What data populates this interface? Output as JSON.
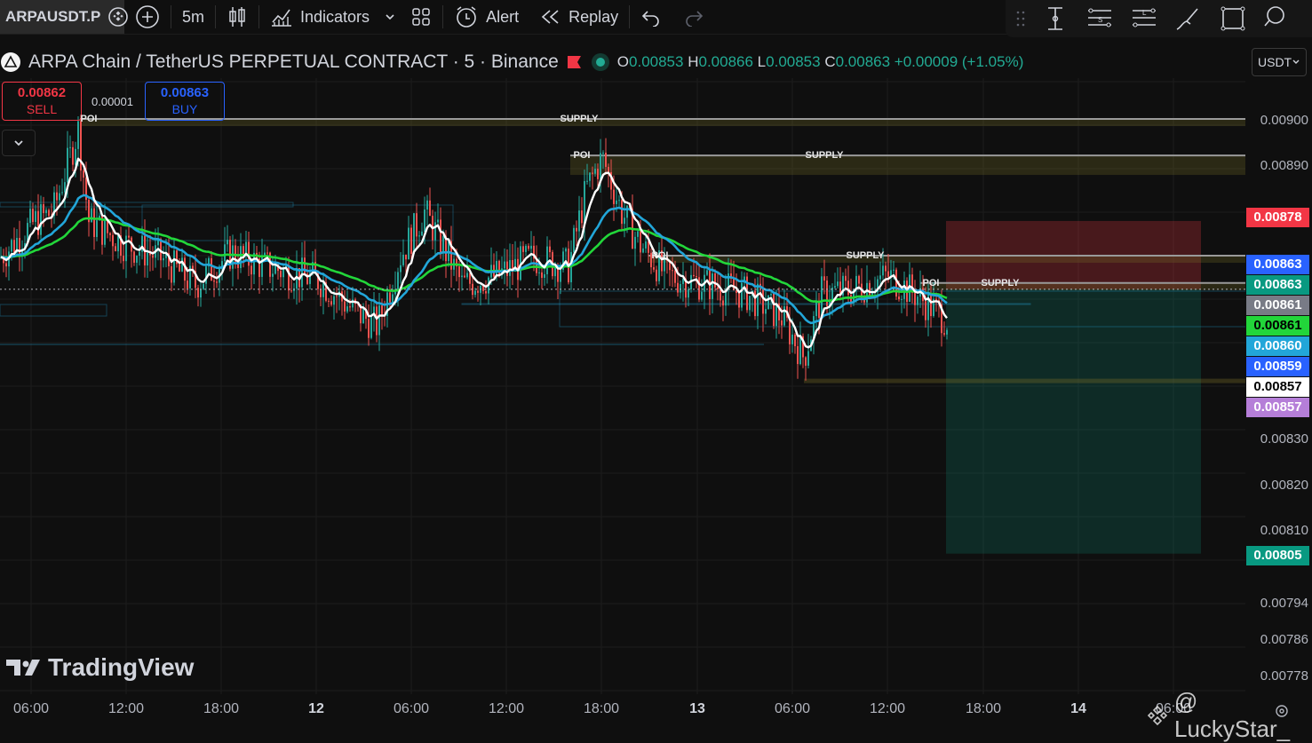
{
  "toolbar": {
    "symbol": "ARPAUSDT.P",
    "interval": "5m",
    "indicators_label": "Indicators",
    "alert_label": "Alert",
    "replay_label": "Replay"
  },
  "legend": {
    "title": "ARPA Chain / TetherUS PERPETUAL CONTRACT · 5 · Binance",
    "open_label": "O",
    "open": "0.00853",
    "high_label": "H",
    "high": "0.00866",
    "low_label": "L",
    "low": "0.00853",
    "close_label": "C",
    "close": "0.00863",
    "change": "+0.00009 (+1.05%)"
  },
  "currency": "USDT",
  "trade": {
    "sell_price": "0.00862",
    "sell_label": "SELL",
    "spread": "0.00001",
    "buy_price": "0.00863",
    "buy_label": "BUY"
  },
  "colors": {
    "background": "#0f0f0f",
    "ema_white": "#ffffff",
    "ema_blue": "#22a6d9",
    "ema_green": "#22d63a",
    "candle_up": "#26a69a",
    "candle_down": "#ef5350"
  },
  "price_axis": {
    "ticks": [
      {
        "label": "0.00900",
        "value": 0.009
      },
      {
        "label": "0.00890",
        "value": 0.0089
      },
      {
        "label": "0.00830",
        "value": 0.0083
      },
      {
        "label": "0.00820",
        "value": 0.0082
      },
      {
        "label": "0.00810",
        "value": 0.0081
      },
      {
        "label": "0.00794",
        "value": 0.00794
      },
      {
        "label": "0.00786",
        "value": 0.00786
      },
      {
        "label": "0.00778",
        "value": 0.00778
      }
    ],
    "labels": [
      {
        "text": "0.00878",
        "value": 0.00878,
        "bg": "#f23645",
        "fg": "#ffffff"
      },
      {
        "text": "0.00863",
        "value": 0.00863,
        "bg": "#2962ff",
        "fg": "#ffffff"
      },
      {
        "text": "0.00863",
        "value": 0.00863,
        "bg": "#089981",
        "fg": "#ffffff"
      },
      {
        "text": "0.00861",
        "value": 0.00861,
        "bg": "#787b86",
        "fg": "#ffffff"
      },
      {
        "text": "0.00861",
        "value": 0.00861,
        "bg": "#22d63a",
        "fg": "#000000"
      },
      {
        "text": "0.00860",
        "value": 0.0086,
        "bg": "#22a6d9",
        "fg": "#ffffff"
      },
      {
        "text": "0.00859",
        "value": 0.00859,
        "bg": "#2962ff",
        "fg": "#ffffff"
      },
      {
        "text": "0.00857",
        "value": 0.00857,
        "bg": "#ffffff",
        "fg": "#000000"
      },
      {
        "text": "0.00857",
        "value": 0.00857,
        "bg": "#b57ed8",
        "fg": "#ffffff"
      },
      {
        "text": "0.00805",
        "value": 0.00805,
        "bg": "#089981",
        "fg": "#ffffff"
      }
    ]
  },
  "time_axis": {
    "ticks": [
      {
        "label": "06:00",
        "bold": false
      },
      {
        "label": "12:00",
        "bold": false
      },
      {
        "label": "18:00",
        "bold": false
      },
      {
        "label": "12",
        "bold": true
      },
      {
        "label": "06:00",
        "bold": false
      },
      {
        "label": "12:00",
        "bold": false
      },
      {
        "label": "18:00",
        "bold": false
      },
      {
        "label": "13",
        "bold": true
      },
      {
        "label": "06:00",
        "bold": false
      },
      {
        "label": "12:00",
        "bold": false
      },
      {
        "label": "18:00",
        "bold": false
      },
      {
        "label": "14",
        "bold": true
      },
      {
        "label": "06:00",
        "bold": false
      }
    ]
  },
  "zones": [
    {
      "label": "SUPPLY",
      "poi": "POI",
      "price": 0.009
    },
    {
      "label": "SUPPLY",
      "poi": "POI",
      "price": 0.00892
    },
    {
      "label": "SUPPLY",
      "poi": "POI",
      "price": 0.0087
    },
    {
      "label": "SUPPLY",
      "poi": "POI",
      "price": 0.00864
    }
  ],
  "position": {
    "type": "short",
    "entry": 0.00863,
    "stop": 0.00878,
    "target": 0.00805
  },
  "branding": {
    "logo_text": "TradingView",
    "watermark": "@ LuckyStar_"
  }
}
